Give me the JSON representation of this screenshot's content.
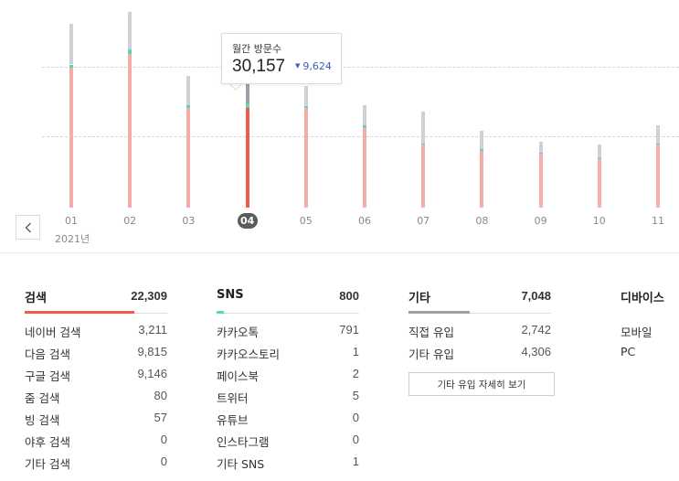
{
  "chart": {
    "year_label": "2021년",
    "months": [
      "01",
      "02",
      "03",
      "04",
      "05",
      "06",
      "07",
      "08",
      "09",
      "10",
      "11"
    ],
    "active_month_index": 3,
    "colors": {
      "search": "#f4aea6",
      "search_active": "#f25b4c",
      "sns": "#5fd4b6",
      "other": "#cdd2d6",
      "other_active": "#9aa0a8"
    },
    "chart_data": {
      "type": "bar",
      "categories": [
        "01",
        "02",
        "03",
        "04",
        "05",
        "06",
        "07",
        "08",
        "09",
        "10",
        "11"
      ],
      "series": [
        {
          "name": "검색",
          "values": [
            24500,
            27000,
            17500,
            17500,
            17500,
            14000,
            11000,
            10000,
            9500,
            8700,
            11000
          ]
        },
        {
          "name": "SNS",
          "values": [
            600,
            800,
            400,
            800,
            300,
            400,
            200,
            200,
            200,
            200,
            200
          ]
        },
        {
          "name": "기타",
          "values": [
            7200,
            6500,
            5200,
            4000,
            3600,
            3500,
            5600,
            3200,
            1900,
            2200,
            3300
          ]
        }
      ],
      "ylim": [
        0,
        34000
      ],
      "grid": true
    }
  },
  "tooltip": {
    "title": "월간 방문수",
    "value": "30,157",
    "delta": "9,624"
  },
  "columns": [
    {
      "name": "검색",
      "total": "22,309",
      "underline_color": "#f25b4c",
      "underline_fraction": 0.77,
      "rows": [
        {
          "label": "네이버 검색",
          "value": "3,211"
        },
        {
          "label": "다음 검색",
          "value": "9,815"
        },
        {
          "label": "구글 검색",
          "value": "9,146"
        },
        {
          "label": "줌 검색",
          "value": "80"
        },
        {
          "label": "빙 검색",
          "value": "57"
        },
        {
          "label": "야후 검색",
          "value": "0"
        },
        {
          "label": "기타 검색",
          "value": "0"
        }
      ]
    },
    {
      "name": "SNS",
      "total": "800",
      "underline_color": "#5fd4b6",
      "underline_fraction": 0.05,
      "rows": [
        {
          "label": "카카오톡",
          "value": "791"
        },
        {
          "label": "카카오스토리",
          "value": "1"
        },
        {
          "label": "페이스북",
          "value": "2"
        },
        {
          "label": "트위터",
          "value": "5"
        },
        {
          "label": "유튜브",
          "value": "0"
        },
        {
          "label": "인스타그램",
          "value": "0"
        },
        {
          "label": "기타 SNS",
          "value": "1"
        }
      ]
    },
    {
      "name": "기타",
      "total": "7,048",
      "underline_color": "#9aa0a8",
      "underline_fraction": 0.43,
      "rows": [
        {
          "label": "직접 유입",
          "value": "2,742"
        },
        {
          "label": "기타 유입",
          "value": "4,306"
        }
      ],
      "button_label": "기타 유입 자세히 보기"
    },
    {
      "name": "디바이스",
      "total": "",
      "rows": [
        {
          "label": "모바일",
          "value": ""
        },
        {
          "label": "PC",
          "value": ""
        }
      ]
    }
  ]
}
